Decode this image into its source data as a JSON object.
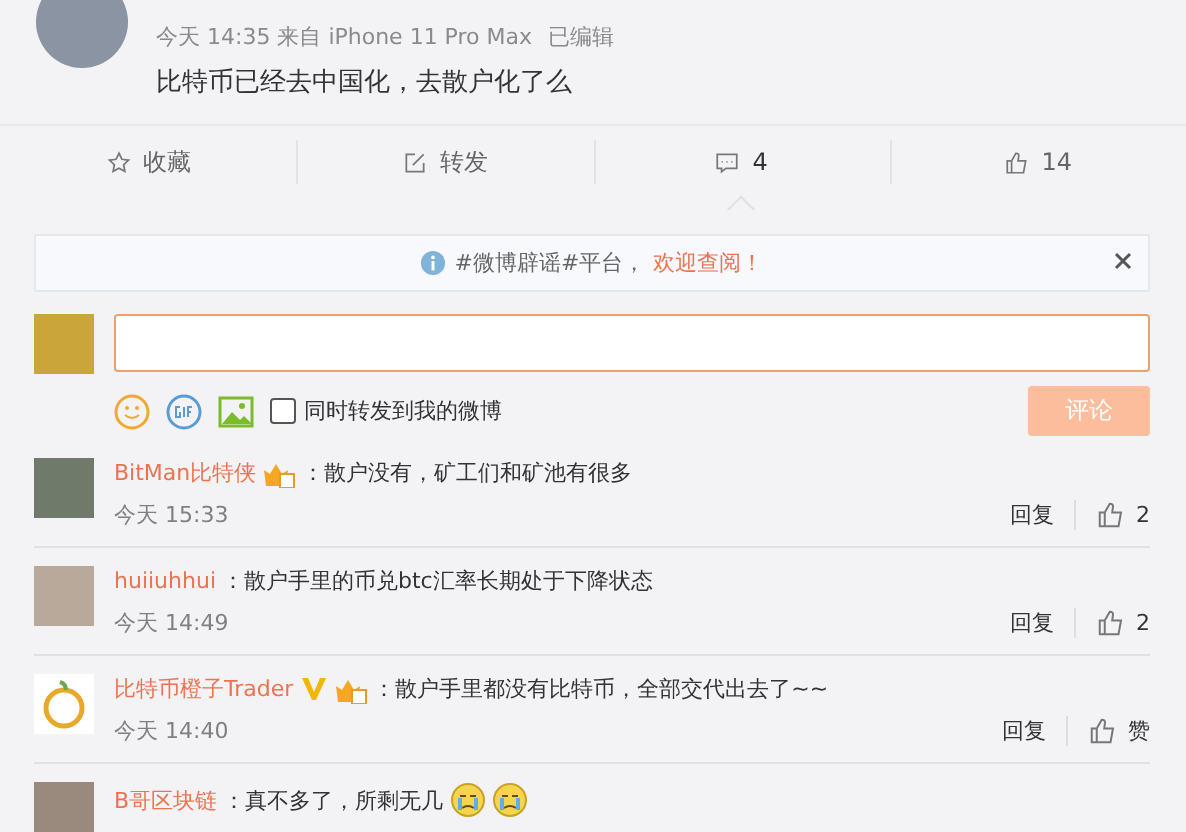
{
  "post": {
    "meta": "今天 14:35 来自 iPhone 11 Pro Max",
    "edited": "已编辑",
    "content": "比特币已经去中国化，去散户化了么"
  },
  "actions": [
    {
      "kind": "favorite",
      "label": "收藏",
      "selected": false
    },
    {
      "kind": "repost",
      "label": "转发",
      "selected": false
    },
    {
      "kind": "comment",
      "label": "4",
      "selected": true
    },
    {
      "kind": "like",
      "label": "14",
      "selected": false
    }
  ],
  "notice": {
    "text": "#微博辟谣#平台，",
    "link": "欢迎查阅！"
  },
  "composer": {
    "repost_label": "同时转发到我的微博",
    "repost_checked": false,
    "submit": "评论"
  },
  "comments": [
    {
      "name": "BitMan比特侠",
      "verified": false,
      "vip": true,
      "text": "：散户没有，矿工们和矿池有很多",
      "time": "今天 15:33",
      "reply": "回复",
      "likes": "2"
    },
    {
      "name": "huiiuhhui",
      "verified": false,
      "vip": false,
      "text": "：散户手里的币兑btc汇率长期处于下降状态",
      "time": "今天 14:49",
      "reply": "回复",
      "likes": "2"
    },
    {
      "name": "比特币橙子Trader",
      "verified": true,
      "vip": true,
      "text": "：散户手里都没有比特币，全部交代出去了~~",
      "time": "今天 14:40",
      "reply": "回复",
      "likes": "赞"
    },
    {
      "name": "B哥区块链",
      "verified": false,
      "vip": false,
      "text": "：真不多了，所剩无几",
      "emojis": [
        {
          "kind": "crying"
        },
        {
          "kind": "crying"
        }
      ]
    }
  ]
}
